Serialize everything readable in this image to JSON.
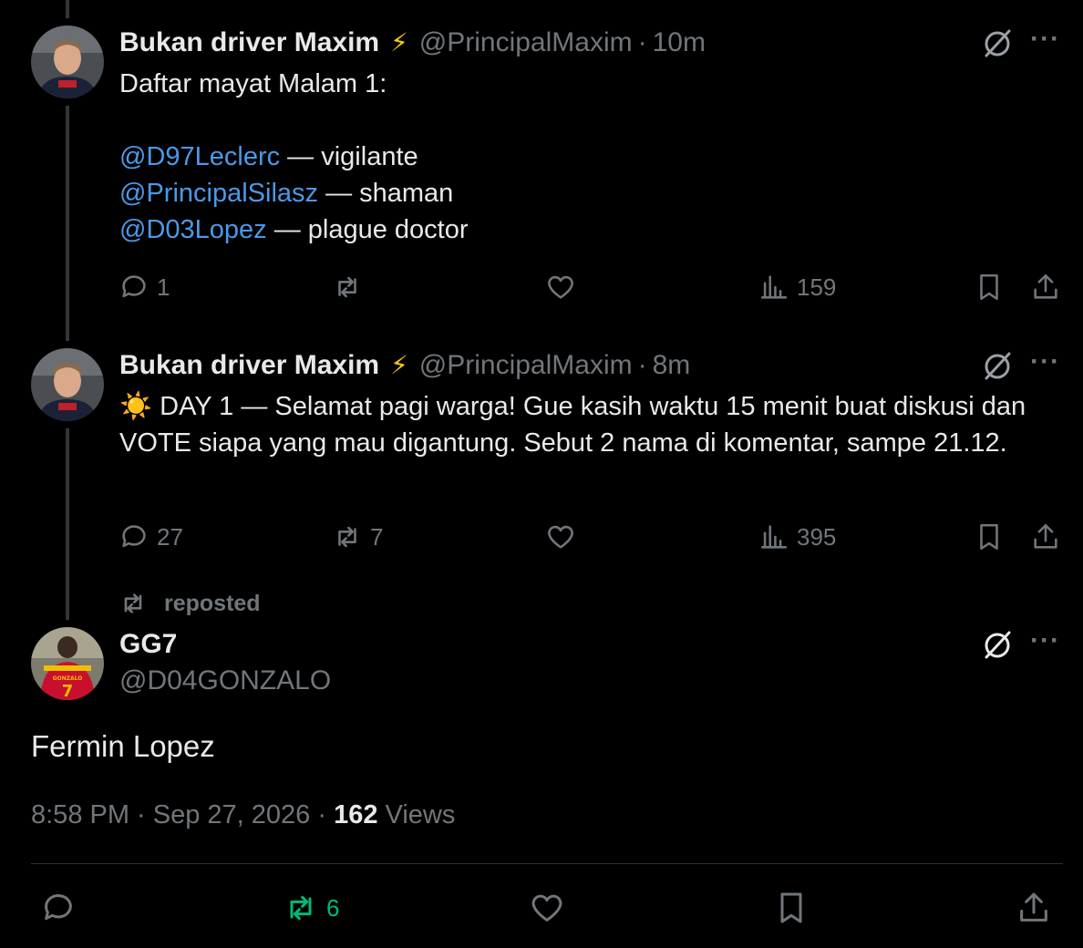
{
  "tweet1": {
    "name": "Bukan driver Maxim",
    "badge": "⚡",
    "handle": "@PrincipalMaxim",
    "time": "10m",
    "line1": "Daftar mayat Malam 1:",
    "entries": [
      {
        "mention": "@D97Leclerc",
        "role": " — vigilante"
      },
      {
        "mention": "@PrincipalSilasz",
        "role": " — shaman"
      },
      {
        "mention": "@D03Lopez",
        "role": " — plague doctor"
      }
    ],
    "replies": "1",
    "views": "159"
  },
  "tweet2": {
    "name": "Bukan driver Maxim",
    "badge": "⚡",
    "handle": "@PrincipalMaxim",
    "time": "8m",
    "sun": "☀️",
    "text": " DAY 1 — Selamat pagi warga! Gue kasih waktu 15 menit buat diskusi dan VOTE siapa yang mau digantung. Sebut 2 nama di komentar, sampe 21.12.",
    "replies": "27",
    "reposts": "7",
    "views": "395"
  },
  "repost_label": "reposted",
  "main": {
    "name": "GG7",
    "handle": "@D04GONZALO",
    "text": "Fermin Lopez",
    "timestamp": "8:58 PM · Sep 27, 2026 · ",
    "views_count": "162",
    "views_label": " Views",
    "reposts": "6",
    "jersey_name": "GONZALO",
    "jersey_number": "7"
  },
  "colors": {
    "accent_link": "#4a99e9",
    "repost_active": "#00ba7c",
    "muted": "#71767b"
  }
}
